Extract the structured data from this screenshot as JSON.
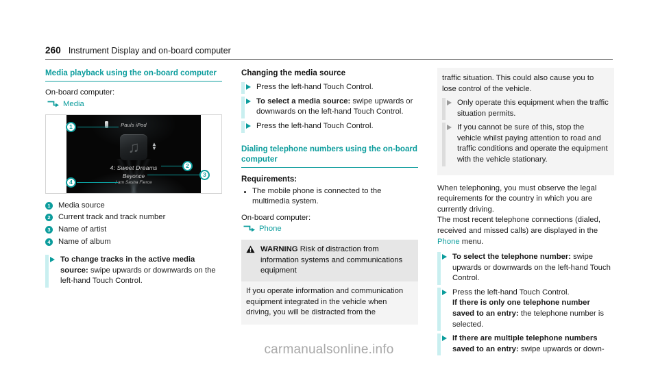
{
  "header": {
    "page_number": "260",
    "title": "Instrument Display and on-board computer"
  },
  "left_column": {
    "heading": "Media playback using the on-board computer",
    "obc_label": "On-board computer:",
    "obc_path": "Media",
    "figure": {
      "source_name": "Pauls iPod",
      "track": "4: Sweet Dreams",
      "artist": "Beyonce",
      "album": "I am Sasha Fierce",
      "note_icon": "music-note-icon",
      "device_icon": "ipod-device-icon",
      "scroll_icon": "up-down-scroll-icon",
      "callouts": [
        "1",
        "2",
        "3",
        "4"
      ]
    },
    "legend": [
      {
        "num": "1",
        "label": "Media source"
      },
      {
        "num": "2",
        "label": "Current track and track number"
      },
      {
        "num": "3",
        "label": "Name of artist"
      },
      {
        "num": "4",
        "label": "Name of album"
      }
    ],
    "steps": [
      {
        "bold": "To change tracks in the active media source:",
        "rest": " swipe upwards or downwards on the left-hand Touch Control."
      }
    ]
  },
  "middle_column": {
    "sub_heading": "Changing the media source",
    "steps": [
      {
        "bold": "",
        "rest": "Press the left-hand Touch Control."
      },
      {
        "bold": "To select a media source:",
        "rest": " swipe upwards or downwards on the left-hand Touch Control."
      },
      {
        "bold": "",
        "rest": "Press the left-hand Touch Control."
      }
    ],
    "heading": "Dialing telephone numbers using the on-board computer",
    "requirements_title": "Requirements:",
    "requirements": [
      "The mobile phone is connected to the multimedia system."
    ],
    "obc_label": "On-board computer:",
    "obc_path": "Phone",
    "warning": {
      "icon": "warning-triangle-icon",
      "label": "WARNING",
      "title": " Risk of distraction from information systems and communications equipment",
      "body": "If you operate information and communication equipment integrated in the vehicle when driving, you will be distracted from the"
    }
  },
  "right_column": {
    "warning_cont": "traffic situation. This could also cause you to lose control of the vehicle.",
    "warning_steps": [
      "Only operate this equipment when the traffic situation permits.",
      "If you cannot be sure of this, stop the vehicle whilst paying attention to road and traffic conditions and operate the equipment with the vehicle stationary."
    ],
    "paragraph_1": "When telephoning, you must observe the legal requirements for the country in which you are currently driving.",
    "paragraph_2_pre": "The most recent telephone connections (dialed, received and missed calls) are displayed in the ",
    "paragraph_2_link": "Phone",
    "paragraph_2_post": " menu.",
    "steps": [
      {
        "bold": "To select the telephone number:",
        "rest": " swipe upwards or downwards on the left-hand Touch Control."
      },
      {
        "bold_second": "If there is only one telephone number saved to an entry:",
        "pre": "Press the left-hand Touch Control.",
        "rest": " the telephone number is selected."
      },
      {
        "bold": "If there are multiple telephone numbers saved to an entry:",
        "rest": " swipe upwards or down-"
      }
    ]
  },
  "watermark": "carmanualsonline.info",
  "colors": {
    "accent": "#0b9c9c",
    "accent_bar": "#c9eff0",
    "warning_bg": "#f4f4f4",
    "warning_head_bg": "#e6e6e6"
  }
}
